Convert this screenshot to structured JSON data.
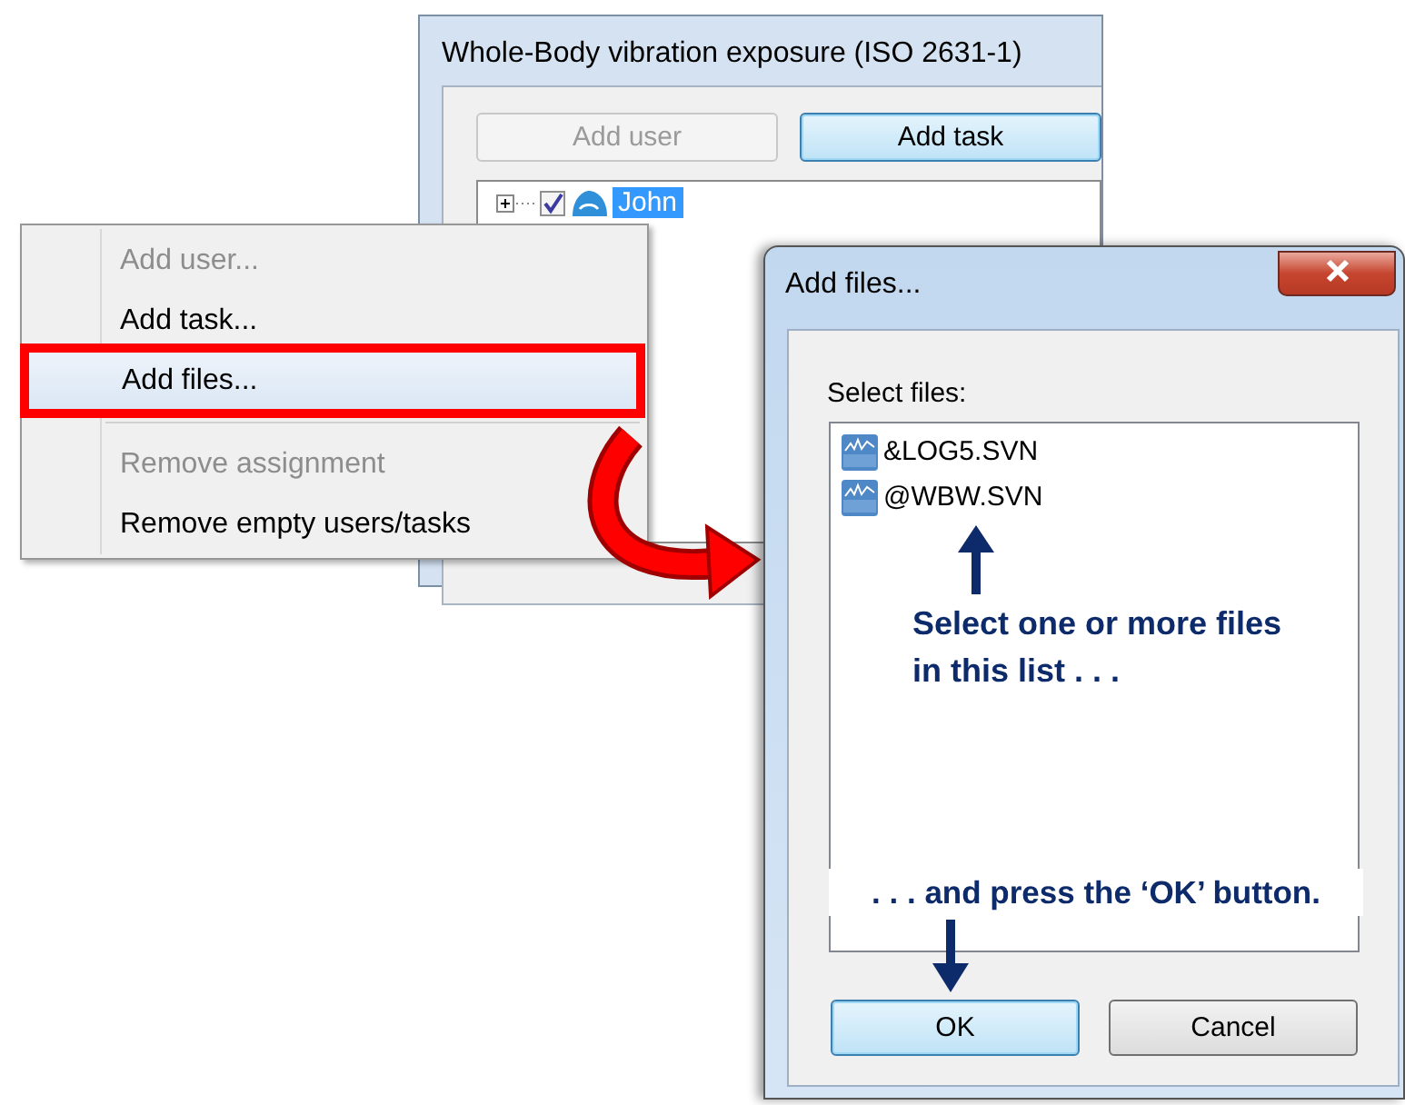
{
  "main_window": {
    "title": "Whole-Body vibration exposure (ISO 2631-1)",
    "buttons": [
      {
        "label": "Add user",
        "disabled": true,
        "focused": false
      },
      {
        "label": "Add task",
        "disabled": false,
        "focused": true
      }
    ],
    "tree": [
      {
        "label": "John",
        "expanded": false,
        "checked": true,
        "selected": true
      }
    ]
  },
  "context_menu": {
    "items": [
      {
        "kind": "item",
        "label": "Add user...",
        "disabled": true,
        "highlighted": false
      },
      {
        "kind": "item",
        "label": "Add task...",
        "disabled": false,
        "highlighted": false
      },
      {
        "kind": "item",
        "label": "Add files...",
        "disabled": false,
        "highlighted": true
      },
      {
        "kind": "separator"
      },
      {
        "kind": "item",
        "label": "Remove assignment",
        "disabled": true,
        "highlighted": false
      },
      {
        "kind": "item",
        "label": "Remove empty users/tasks",
        "disabled": false,
        "highlighted": false
      }
    ]
  },
  "dialog": {
    "title": "Add files...",
    "list_label": "Select files:",
    "files": [
      {
        "name": "&LOG5.SVN"
      },
      {
        "name": "@WBW.SVN"
      }
    ],
    "buttons": [
      {
        "label": "OK",
        "default": true
      },
      {
        "label": "Cancel",
        "default": false
      }
    ],
    "annotations": [
      {
        "text": "Select one or more files in this list . . ."
      },
      {
        "text": ". . . and press the ‘OK’ button."
      }
    ]
  }
}
